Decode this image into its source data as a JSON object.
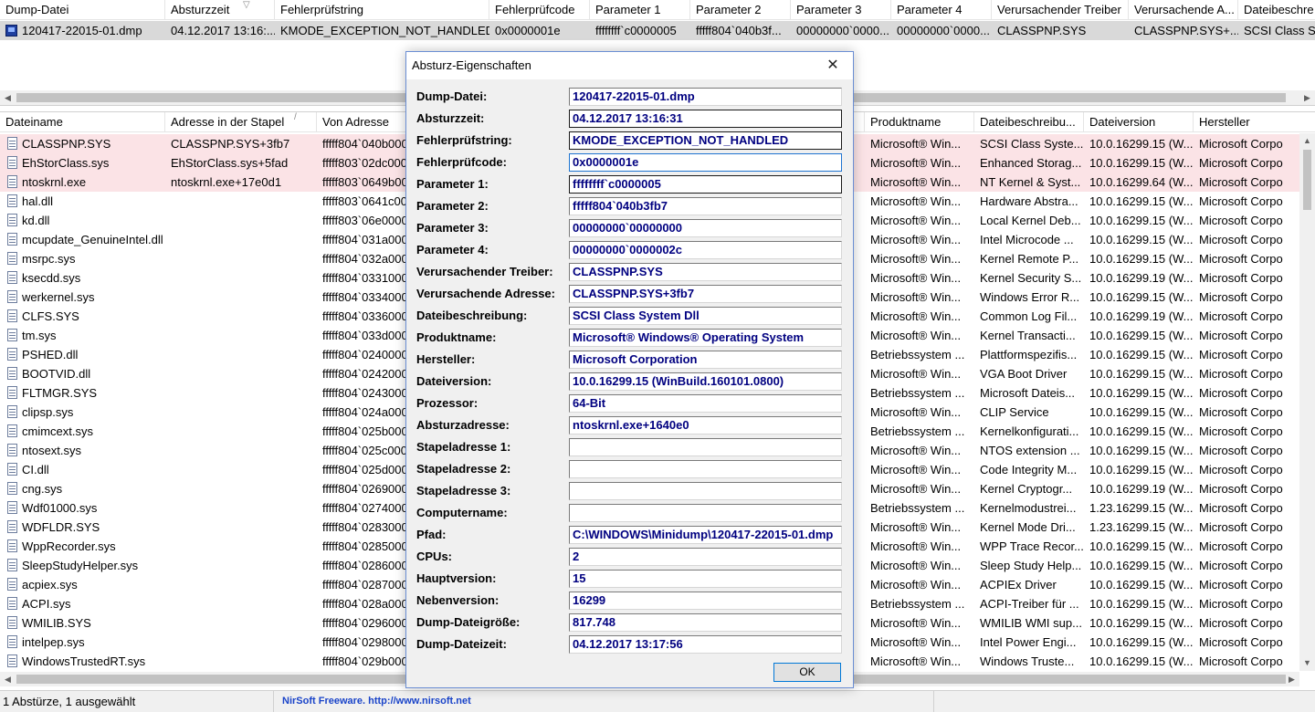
{
  "top_list": {
    "columns": [
      "Dump-Datei",
      "Absturzzeit",
      "Fehlerprüfstring",
      "Fehlerprüfcode",
      "Parameter 1",
      "Parameter 2",
      "Parameter 3",
      "Parameter 4",
      "Verursachender Treiber",
      "Verursachende A...",
      "Dateibeschre"
    ],
    "sort_indicator": "▽",
    "rows": [
      [
        "120417-22015-01.dmp",
        "04.12.2017 13:16:...",
        "KMODE_EXCEPTION_NOT_HANDLED",
        "0x0000001e",
        "ffffffff`c0000005",
        "fffff804`040b3f...",
        "00000000`0000...",
        "00000000`0000...",
        "CLASSPNP.SYS",
        "CLASSPNP.SYS+...",
        "SCSI Class Sy"
      ]
    ]
  },
  "bottom_list": {
    "columns": [
      "Dateiname",
      "Adresse in der Stapel",
      "Von Adresse",
      "Produktname",
      "Dateibeschreibu...",
      "Dateiversion",
      "Hersteller"
    ],
    "sort_indicator": "/",
    "rows": [
      [
        "CLASSPNP.SYS",
        "CLASSPNP.SYS+3fb7",
        "fffff804`040b000",
        "Microsoft® Win...",
        "SCSI Class Syste...",
        "10.0.16299.15 (W...",
        "Microsoft Corpo"
      ],
      [
        "EhStorClass.sys",
        "EhStorClass.sys+5fad",
        "fffff803`02dc000",
        "Microsoft® Win...",
        "Enhanced Storag...",
        "10.0.16299.15 (W...",
        "Microsoft Corpo"
      ],
      [
        "ntoskrnl.exe",
        "ntoskrnl.exe+17e0d1",
        "fffff803`0649b00",
        "Microsoft® Win...",
        "NT Kernel & Syst...",
        "10.0.16299.64 (W...",
        "Microsoft Corpo"
      ],
      [
        "hal.dll",
        "",
        "fffff803`0641c00",
        "Microsoft® Win...",
        "Hardware Abstra...",
        "10.0.16299.15 (W...",
        "Microsoft Corpo"
      ],
      [
        "kd.dll",
        "",
        "fffff803`06e0000",
        "Microsoft® Win...",
        "Local Kernel Deb...",
        "10.0.16299.15 (W...",
        "Microsoft Corpo"
      ],
      [
        "mcupdate_GenuineIntel.dll",
        "",
        "fffff804`031a000",
        "Microsoft® Win...",
        "Intel Microcode ...",
        "10.0.16299.15 (W...",
        "Microsoft Corpo"
      ],
      [
        "msrpc.sys",
        "",
        "fffff804`032a000",
        "Microsoft® Win...",
        "Kernel Remote P...",
        "10.0.16299.15 (W...",
        "Microsoft Corpo"
      ],
      [
        "ksecdd.sys",
        "",
        "fffff804`0331000",
        "Microsoft® Win...",
        "Kernel Security S...",
        "10.0.16299.19 (W...",
        "Microsoft Corpo"
      ],
      [
        "werkernel.sys",
        "",
        "fffff804`0334000",
        "Microsoft® Win...",
        "Windows Error R...",
        "10.0.16299.15 (W...",
        "Microsoft Corpo"
      ],
      [
        "CLFS.SYS",
        "",
        "fffff804`0336000",
        "Microsoft® Win...",
        "Common Log Fil...",
        "10.0.16299.19 (W...",
        "Microsoft Corpo"
      ],
      [
        "tm.sys",
        "",
        "fffff804`033d000",
        "Microsoft® Win...",
        "Kernel Transacti...",
        "10.0.16299.15 (W...",
        "Microsoft Corpo"
      ],
      [
        "PSHED.dll",
        "",
        "fffff804`0240000",
        "Betriebssystem ...",
        "Plattformspezifis...",
        "10.0.16299.15 (W...",
        "Microsoft Corpo"
      ],
      [
        "BOOTVID.dll",
        "",
        "fffff804`0242000",
        "Microsoft® Win...",
        "VGA Boot Driver",
        "10.0.16299.15 (W...",
        "Microsoft Corpo"
      ],
      [
        "FLTMGR.SYS",
        "",
        "fffff804`0243000",
        "Betriebssystem ...",
        "Microsoft Dateis...",
        "10.0.16299.15 (W...",
        "Microsoft Corpo"
      ],
      [
        "clipsp.sys",
        "",
        "fffff804`024a000",
        "Microsoft® Win...",
        "CLIP Service",
        "10.0.16299.15 (W...",
        "Microsoft Corpo"
      ],
      [
        "cmimcext.sys",
        "",
        "fffff804`025b000",
        "Betriebssystem ...",
        "Kernelkonfigurati...",
        "10.0.16299.15 (W...",
        "Microsoft Corpo"
      ],
      [
        "ntosext.sys",
        "",
        "fffff804`025c000",
        "Microsoft® Win...",
        "NTOS extension ...",
        "10.0.16299.15 (W...",
        "Microsoft Corpo"
      ],
      [
        "CI.dll",
        "",
        "fffff804`025d000",
        "Microsoft® Win...",
        "Code Integrity M...",
        "10.0.16299.15 (W...",
        "Microsoft Corpo"
      ],
      [
        "cng.sys",
        "",
        "fffff804`0269000",
        "Microsoft® Win...",
        "Kernel Cryptogr...",
        "10.0.16299.19 (W...",
        "Microsoft Corpo"
      ],
      [
        "Wdf01000.sys",
        "",
        "fffff804`0274000",
        "Betriebssystem ...",
        "Kernelmodustrei...",
        "1.23.16299.15 (W...",
        "Microsoft Corpo"
      ],
      [
        "WDFLDR.SYS",
        "",
        "fffff804`0283000",
        "Microsoft® Win...",
        "Kernel Mode Dri...",
        "1.23.16299.15 (W...",
        "Microsoft Corpo"
      ],
      [
        "WppRecorder.sys",
        "",
        "fffff804`0285000",
        "Microsoft® Win...",
        "WPP Trace Recor...",
        "10.0.16299.15 (W...",
        "Microsoft Corpo"
      ],
      [
        "SleepStudyHelper.sys",
        "",
        "fffff804`0286000",
        "Microsoft® Win...",
        "Sleep Study Help...",
        "10.0.16299.15 (W...",
        "Microsoft Corpo"
      ],
      [
        "acpiex.sys",
        "",
        "fffff804`0287000",
        "Microsoft® Win...",
        "ACPIEx Driver",
        "10.0.16299.15 (W...",
        "Microsoft Corpo"
      ],
      [
        "ACPI.sys",
        "",
        "fffff804`028a000",
        "Betriebssystem ...",
        "ACPI-Treiber für ...",
        "10.0.16299.15 (W...",
        "Microsoft Corpo"
      ],
      [
        "WMILIB.SYS",
        "",
        "fffff804`0296000",
        "Microsoft® Win...",
        "WMILIB WMI sup...",
        "10.0.16299.15 (W...",
        "Microsoft Corpo"
      ],
      [
        "intelpep.sys",
        "",
        "fffff804`0298000",
        "Microsoft® Win...",
        "Intel Power Engi...",
        "10.0.16299.15 (W...",
        "Microsoft Corpo"
      ],
      [
        "WindowsTrustedRT.sys",
        "",
        "fffff804`029b000",
        "Microsoft® Win...",
        "Windows Truste...",
        "10.0.16299.15 (W...",
        "Microsoft Corpo"
      ]
    ]
  },
  "status_bar": {
    "count": "1 Abstürze, 1 ausgewählt",
    "link": "NirSoft Freeware.  http://www.nirsoft.net"
  },
  "dialog": {
    "title": "Absturz-Eigenschaften",
    "close_glyph": "✕",
    "fields": [
      {
        "label": "Dump-Datei:",
        "value": "120417-22015-01.dmp"
      },
      {
        "label": "Absturzzeit:",
        "value": "04.12.2017 13:16:31"
      },
      {
        "label": "Fehlerprüfstring:",
        "value": "KMODE_EXCEPTION_NOT_HANDLED"
      },
      {
        "label": "Fehlerprüfcode:",
        "value": "0x0000001e"
      },
      {
        "label": "Parameter 1:",
        "value": "ffffffff`c0000005"
      },
      {
        "label": "Parameter 2:",
        "value": "fffff804`040b3fb7"
      },
      {
        "label": "Parameter 3:",
        "value": "00000000`00000000"
      },
      {
        "label": "Parameter 4:",
        "value": "00000000`0000002c"
      },
      {
        "label": "Verursachender Treiber:",
        "value": "CLASSPNP.SYS"
      },
      {
        "label": "Verursachende Adresse:",
        "value": "CLASSPNP.SYS+3fb7"
      },
      {
        "label": "Dateibeschreibung:",
        "value": "SCSI Class System Dll"
      },
      {
        "label": "Produktname:",
        "value": "Microsoft® Windows® Operating System"
      },
      {
        "label": "Hersteller:",
        "value": "Microsoft Corporation"
      },
      {
        "label": "Dateiversion:",
        "value": "10.0.16299.15 (WinBuild.160101.0800)"
      },
      {
        "label": "Prozessor:",
        "value": "64-Bit"
      },
      {
        "label": "Absturzadresse:",
        "value": "ntoskrnl.exe+1640e0"
      },
      {
        "label": "Stapeladresse 1:",
        "value": ""
      },
      {
        "label": "Stapeladresse 2:",
        "value": ""
      },
      {
        "label": "Stapeladresse 3:",
        "value": ""
      },
      {
        "label": "Computername:",
        "value": ""
      },
      {
        "label": "Pfad:",
        "value": "C:\\WINDOWS\\Minidump\\120417-22015-01.dmp"
      },
      {
        "label": "CPUs:",
        "value": "2"
      },
      {
        "label": "Hauptversion:",
        "value": "15"
      },
      {
        "label": "Nebenversion:",
        "value": "16299"
      },
      {
        "label": "Dump-Dateigröße:",
        "value": "817.748"
      },
      {
        "label": "Dump-Dateizeit:",
        "value": "04.12.2017 13:17:56"
      }
    ],
    "ok_label": "OK"
  },
  "colors": {
    "value_text": "#000080",
    "highlight_row": "#fbe3e6",
    "selected_row": "#d9d9d9",
    "link": "#1a44c9"
  },
  "icons": [
    "dump-file-icon",
    "module-file-icon",
    "close-icon",
    "sort-arrow-icon",
    "scroll-left-icon",
    "scroll-right-icon",
    "scroll-up-icon",
    "scroll-down-icon"
  ]
}
